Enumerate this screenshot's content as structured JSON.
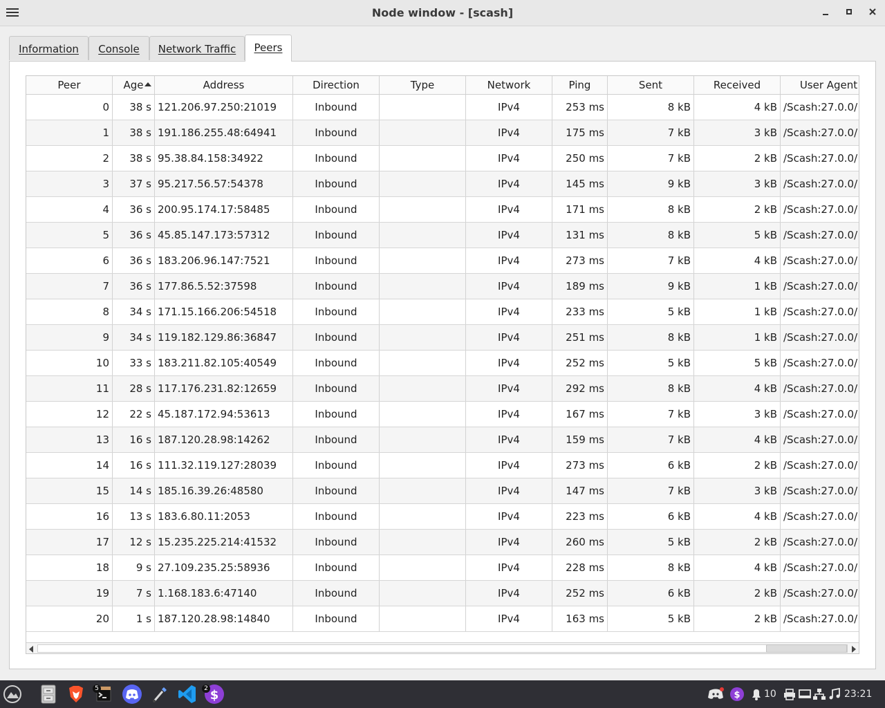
{
  "window": {
    "title": "Node window - [scash]"
  },
  "tabs": [
    {
      "label": "Information",
      "active": false
    },
    {
      "label": "Console",
      "active": false
    },
    {
      "label": "Network Traffic",
      "active": false
    },
    {
      "label": "Peers",
      "active": true
    }
  ],
  "peers": {
    "sort_column": "Age",
    "sort_order": "ascending",
    "columns": [
      "Peer",
      "Age",
      "Address",
      "Direction",
      "Type",
      "Network",
      "Ping",
      "Sent",
      "Received",
      "User Agent"
    ],
    "rows": [
      [
        "0",
        "38 s",
        "121.206.97.250:21019",
        "Inbound",
        "",
        "IPv4",
        "253 ms",
        "8 kB",
        "4 kB",
        "/Scash:27.0.0/"
      ],
      [
        "1",
        "38 s",
        "191.186.255.48:64941",
        "Inbound",
        "",
        "IPv4",
        "175 ms",
        "7 kB",
        "3 kB",
        "/Scash:27.0.0/"
      ],
      [
        "2",
        "38 s",
        "95.38.84.158:34922",
        "Inbound",
        "",
        "IPv4",
        "250 ms",
        "7 kB",
        "2 kB",
        "/Scash:27.0.0/"
      ],
      [
        "3",
        "37 s",
        "95.217.56.57:54378",
        "Inbound",
        "",
        "IPv4",
        "145 ms",
        "9 kB",
        "3 kB",
        "/Scash:27.0.0/"
      ],
      [
        "4",
        "36 s",
        "200.95.174.17:58485",
        "Inbound",
        "",
        "IPv4",
        "171 ms",
        "8 kB",
        "2 kB",
        "/Scash:27.0.0/"
      ],
      [
        "5",
        "36 s",
        "45.85.147.173:57312",
        "Inbound",
        "",
        "IPv4",
        "131 ms",
        "8 kB",
        "5 kB",
        "/Scash:27.0.0/"
      ],
      [
        "6",
        "36 s",
        "183.206.96.147:7521",
        "Inbound",
        "",
        "IPv4",
        "273 ms",
        "7 kB",
        "4 kB",
        "/Scash:27.0.0/"
      ],
      [
        "7",
        "36 s",
        "177.86.5.52:37598",
        "Inbound",
        "",
        "IPv4",
        "189 ms",
        "9 kB",
        "1 kB",
        "/Scash:27.0.0/"
      ],
      [
        "8",
        "34 s",
        "171.15.166.206:54518",
        "Inbound",
        "",
        "IPv4",
        "233 ms",
        "5 kB",
        "1 kB",
        "/Scash:27.0.0/"
      ],
      [
        "9",
        "34 s",
        "119.182.129.86:36847",
        "Inbound",
        "",
        "IPv4",
        "251 ms",
        "8 kB",
        "1 kB",
        "/Scash:27.0.0/"
      ],
      [
        "10",
        "33 s",
        "183.211.82.105:40549",
        "Inbound",
        "",
        "IPv4",
        "252 ms",
        "5 kB",
        "5 kB",
        "/Scash:27.0.0/"
      ],
      [
        "11",
        "28 s",
        "117.176.231.82:12659",
        "Inbound",
        "",
        "IPv4",
        "292 ms",
        "8 kB",
        "4 kB",
        "/Scash:27.0.0/"
      ],
      [
        "12",
        "22 s",
        "45.187.172.94:53613",
        "Inbound",
        "",
        "IPv4",
        "167 ms",
        "7 kB",
        "3 kB",
        "/Scash:27.0.0/"
      ],
      [
        "13",
        "16 s",
        "187.120.28.98:14262",
        "Inbound",
        "",
        "IPv4",
        "159 ms",
        "7 kB",
        "4 kB",
        "/Scash:27.0.0/"
      ],
      [
        "14",
        "16 s",
        "111.32.119.127:28039",
        "Inbound",
        "",
        "IPv4",
        "273 ms",
        "6 kB",
        "2 kB",
        "/Scash:27.0.0/"
      ],
      [
        "15",
        "14 s",
        "185.16.39.26:48580",
        "Inbound",
        "",
        "IPv4",
        "147 ms",
        "7 kB",
        "3 kB",
        "/Scash:27.0.0/"
      ],
      [
        "16",
        "13 s",
        "183.6.80.11:2053",
        "Inbound",
        "",
        "IPv4",
        "223 ms",
        "6 kB",
        "4 kB",
        "/Scash:27.0.0/"
      ],
      [
        "17",
        "12 s",
        "15.235.225.214:41532",
        "Inbound",
        "",
        "IPv4",
        "260 ms",
        "5 kB",
        "2 kB",
        "/Scash:27.0.0/"
      ],
      [
        "18",
        "9 s",
        "27.109.235.25:58936",
        "Inbound",
        "",
        "IPv4",
        "228 ms",
        "8 kB",
        "4 kB",
        "/Scash:27.0.0/"
      ],
      [
        "19",
        "7 s",
        "1.168.183.6:47140",
        "Inbound",
        "",
        "IPv4",
        "252 ms",
        "6 kB",
        "2 kB",
        "/Scash:27.0.0/"
      ],
      [
        "20",
        "1 s",
        "187.120.28.98:14840",
        "Inbound",
        "",
        "IPv4",
        "163 ms",
        "5 kB",
        "2 kB",
        "/Scash:27.0.0/"
      ]
    ]
  },
  "taskbar": {
    "icons": [
      "launcher-icon",
      "file-cabinet-icon",
      "brave-browser-icon",
      "terminal-icon",
      "discord-icon",
      "color-picker-icon",
      "vscode-icon",
      "scash-wallet-icon"
    ],
    "terminal_badge": "5",
    "wallet_badge": "2",
    "notification_count": "10",
    "clock": "23:21"
  }
}
